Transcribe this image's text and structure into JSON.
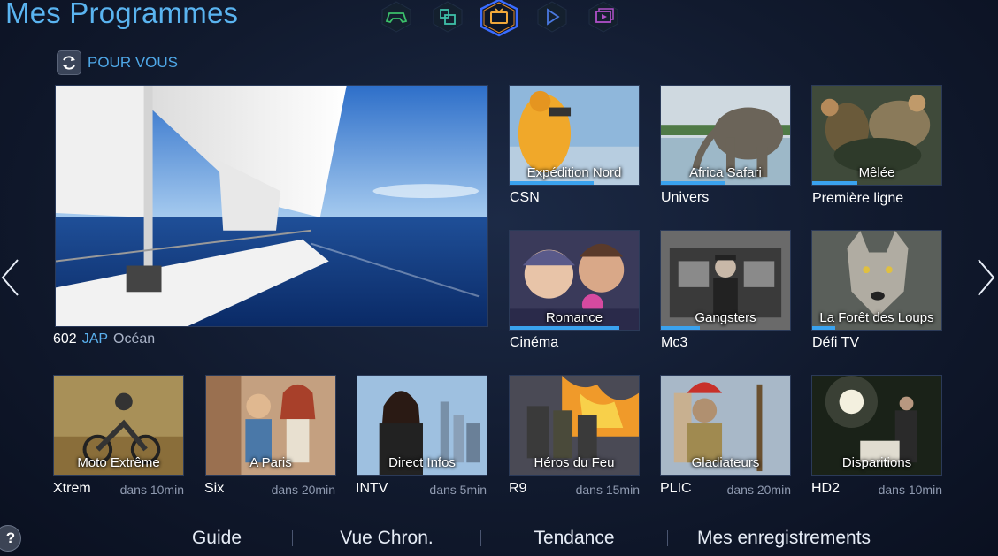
{
  "header": {
    "title": "Mes Programmes",
    "hub_icons": [
      {
        "name": "games-icon",
        "color": "#3bbf6a"
      },
      {
        "name": "apps-icon",
        "color": "#3ec0a8"
      },
      {
        "name": "tv-icon",
        "color": "#f0a83a"
      },
      {
        "name": "play-icon",
        "color": "#4a78e0"
      },
      {
        "name": "photos-icon",
        "color": "#b050c8"
      }
    ],
    "active_hub": "tv-icon"
  },
  "section": {
    "label": "POUR VOUS"
  },
  "hero": {
    "channel": "602",
    "network": "JAP",
    "program": "Océan"
  },
  "grid_top": [
    {
      "title": "Expédition Nord",
      "channel": "CSN",
      "progress": 0.65
    },
    {
      "title": "Africa Safari",
      "channel": "Univers",
      "progress": 0.5
    },
    {
      "title": "Mêlée",
      "channel": "Première ligne",
      "progress": 0.35
    },
    {
      "title": "Romance",
      "channel": "Cinéma",
      "progress": 0.85
    },
    {
      "title": "Gangsters",
      "channel": "Mc3",
      "progress": 0.3
    },
    {
      "title": "La Forêt des Loups",
      "channel": "Défi TV",
      "progress": 0.18
    }
  ],
  "upcoming": [
    {
      "title": "Moto Extrême",
      "channel": "Xtrem",
      "time": "dans 10min"
    },
    {
      "title": "A Paris",
      "channel": "Six",
      "time": "dans 20min"
    },
    {
      "title": "Direct Infos",
      "channel": "INTV",
      "time": "dans 5min"
    },
    {
      "title": "Héros du Feu",
      "channel": "R9",
      "time": "dans 15min"
    },
    {
      "title": "Gladiateurs",
      "channel": "PLIC",
      "time": "dans 20min"
    },
    {
      "title": "Disparitions",
      "channel": "HD2",
      "time": "dans 10min"
    }
  ],
  "help": "?",
  "bottom_nav": [
    "Guide",
    "Vue Chron.",
    "Tendance",
    "Mes enregistrements"
  ],
  "colors": {
    "accent": "#4fa8e8",
    "title": "#5ab4f0",
    "progress": "#3aa2ee"
  }
}
